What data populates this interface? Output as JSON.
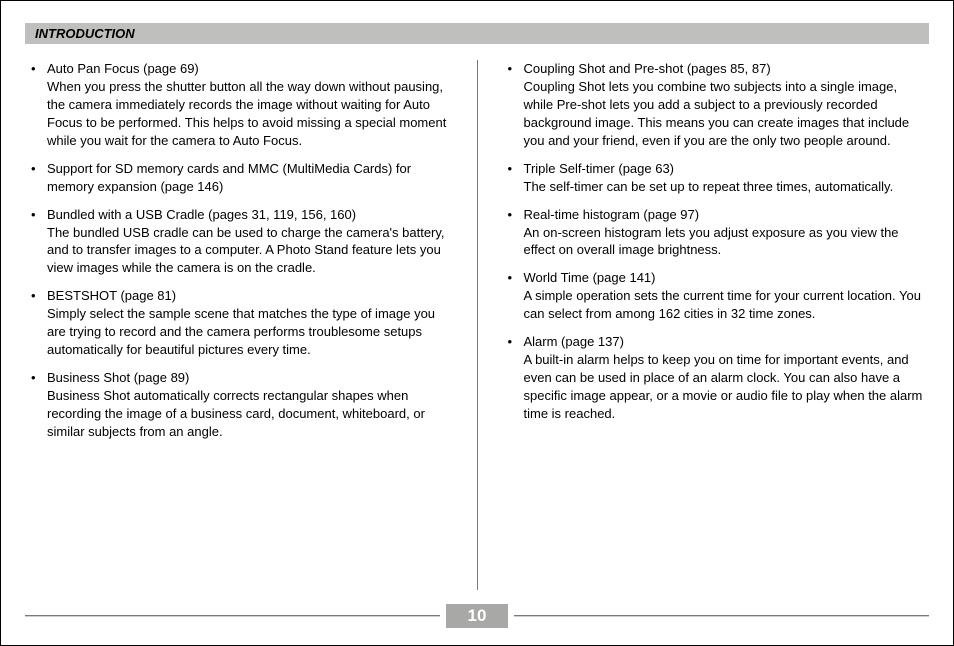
{
  "section_title": "INTRODUCTION",
  "page_number": "10",
  "columns": {
    "left": [
      {
        "title": "Auto Pan Focus (page 69)",
        "body": "When you press the shutter button all the way down without pausing, the camera immediately records the image without waiting for Auto Focus to be performed. This helps to avoid missing a special moment while you wait for the camera to Auto Focus."
      },
      {
        "title": "Support for SD memory cards and MMC (MultiMedia Cards) for memory expansion (page 146)",
        "body": ""
      },
      {
        "title": "Bundled with a USB Cradle (pages 31, 119, 156, 160)",
        "body": "The bundled USB cradle can be used to charge the camera's battery, and to transfer images to a computer. A Photo Stand feature lets you view images while the camera is on the cradle."
      },
      {
        "title": "BESTSHOT (page 81)",
        "body": "Simply select the sample scene that matches the type of image you are trying to record and the camera performs troublesome setups automatically for beautiful pictures every time."
      },
      {
        "title": "Business Shot (page 89)",
        "body": "Business Shot automatically corrects rectangular shapes when recording the image of a business card, document, whiteboard, or similar subjects from an angle."
      }
    ],
    "right": [
      {
        "title": "Coupling Shot and Pre-shot (pages 85, 87)",
        "body": "Coupling Shot lets you combine two subjects into a single image, while Pre-shot lets you add a subject to a previously recorded background image. This means you can create images that include you and your friend, even if you are the only two people around."
      },
      {
        "title": "Triple Self-timer (page 63)",
        "body": "The self-timer can be set up to repeat three times, automatically."
      },
      {
        "title": "Real-time histogram (page 97)",
        "body": "An on-screen histogram lets you adjust exposure as you view the effect on overall image brightness."
      },
      {
        "title": "World Time (page 141)",
        "body": "A simple operation sets the current time for your current location. You can select from among 162 cities in 32 time zones."
      },
      {
        "title": "Alarm (page 137)",
        "body": "A built-in alarm helps to keep you on time for important events, and even can be used in place of an alarm clock. You can also have a specific image appear, or a movie or audio file to play when the alarm time is reached."
      }
    ]
  }
}
